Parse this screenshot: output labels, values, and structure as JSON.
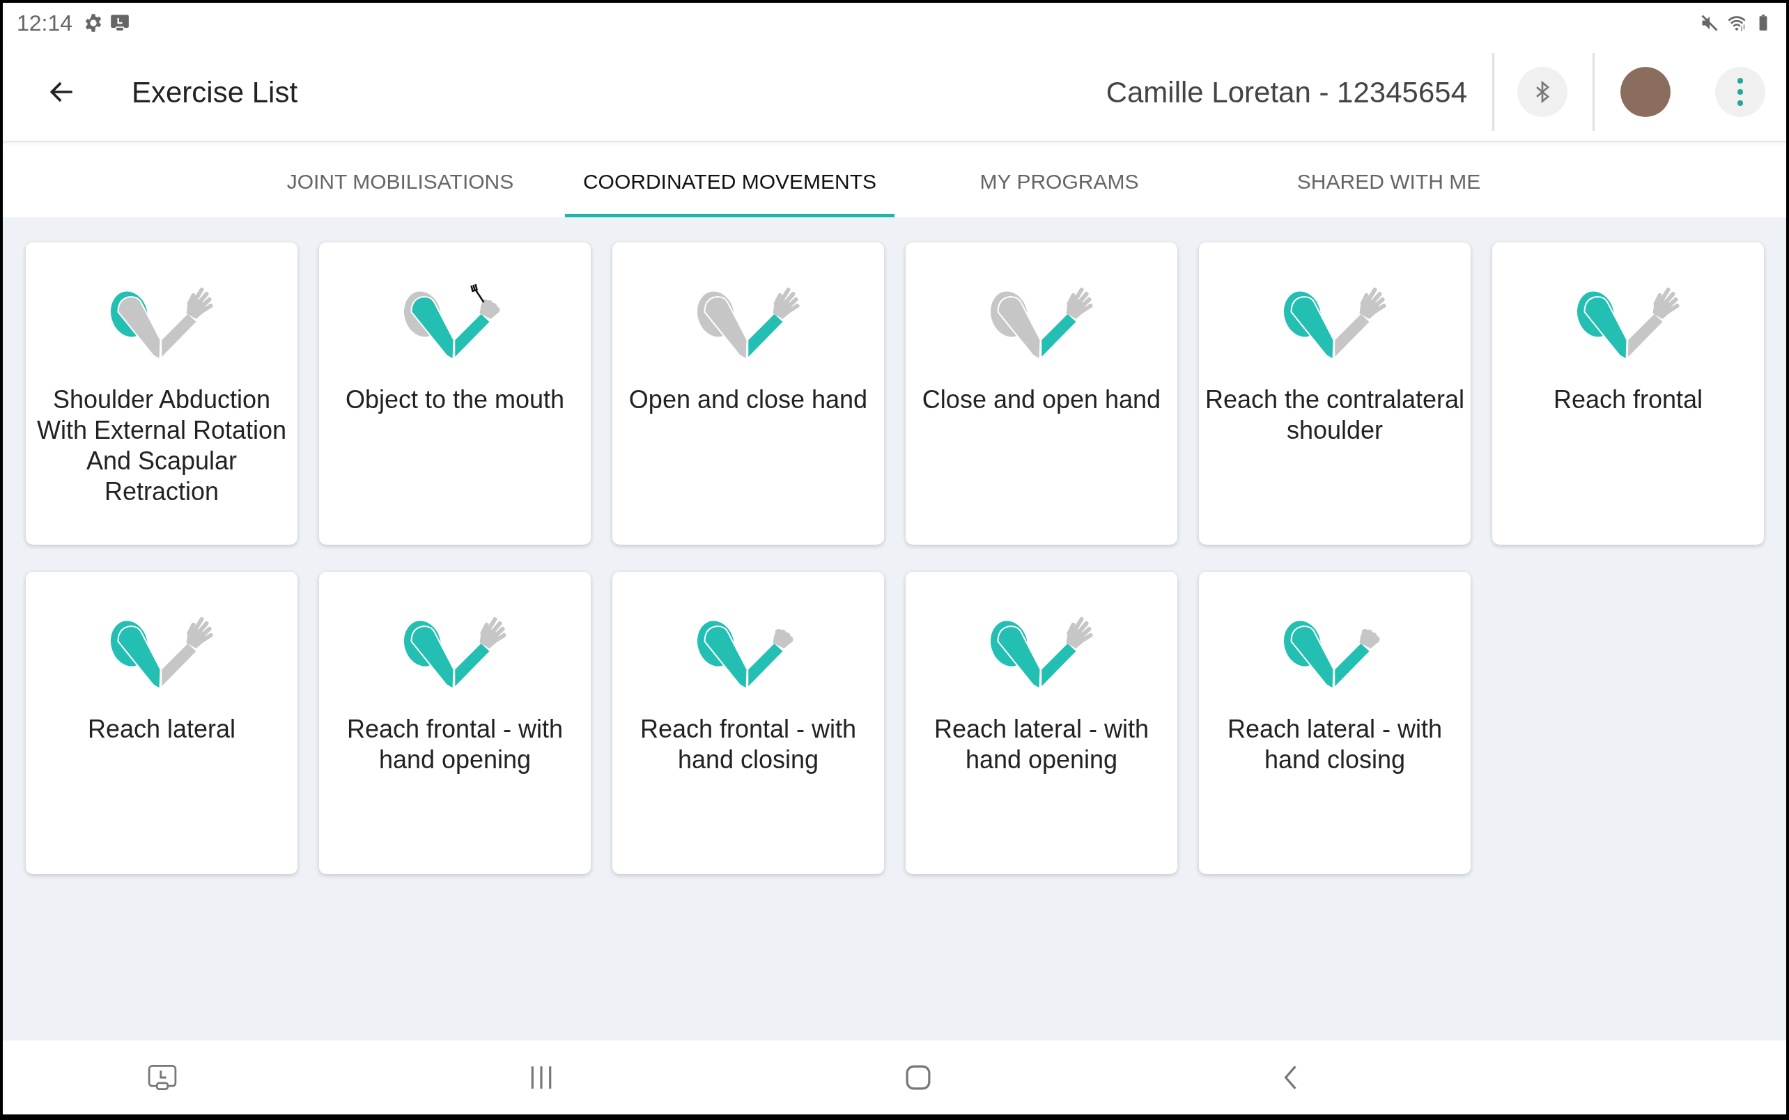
{
  "status_bar": {
    "time": "12:14"
  },
  "header": {
    "title": "Exercise List",
    "patient": "Camille Loretan - 12345654"
  },
  "tabs": [
    {
      "label": "JOINT MOBILISATIONS",
      "selected": false
    },
    {
      "label": "COORDINATED MOVEMENTS",
      "selected": true
    },
    {
      "label": "MY PROGRAMS",
      "selected": false
    },
    {
      "label": "SHARED WITH ME",
      "selected": false
    }
  ],
  "exercises": [
    {
      "title": "Shoulder Abduction With External Rotation And Scapular Retraction",
      "shoulder": true,
      "upper_arm": false,
      "forearm": false,
      "hand_closed": false,
      "utensil": false
    },
    {
      "title": "Object to the mouth",
      "shoulder": false,
      "upper_arm": true,
      "forearm": true,
      "hand_closed": true,
      "utensil": true
    },
    {
      "title": "Open and close hand",
      "shoulder": false,
      "upper_arm": false,
      "forearm": true,
      "hand_closed": false,
      "utensil": false
    },
    {
      "title": "Close and open hand",
      "shoulder": false,
      "upper_arm": false,
      "forearm": true,
      "hand_closed": false,
      "utensil": false
    },
    {
      "title": "Reach the contralateral shoulder",
      "shoulder": true,
      "upper_arm": true,
      "forearm": false,
      "hand_closed": false,
      "utensil": false
    },
    {
      "title": "Reach frontal",
      "shoulder": true,
      "upper_arm": true,
      "forearm": false,
      "hand_closed": false,
      "utensil": false
    },
    {
      "title": "Reach lateral",
      "shoulder": true,
      "upper_arm": true,
      "forearm": false,
      "hand_closed": false,
      "utensil": false
    },
    {
      "title": "Reach frontal - with hand opening",
      "shoulder": true,
      "upper_arm": true,
      "forearm": true,
      "hand_closed": false,
      "utensil": false
    },
    {
      "title": "Reach frontal - with hand closing",
      "shoulder": true,
      "upper_arm": true,
      "forearm": true,
      "hand_closed": true,
      "utensil": false
    },
    {
      "title": "Reach lateral - with hand opening",
      "shoulder": true,
      "upper_arm": true,
      "forearm": true,
      "hand_closed": false,
      "utensil": false
    },
    {
      "title": "Reach lateral - with hand closing",
      "shoulder": true,
      "upper_arm": true,
      "forearm": true,
      "hand_closed": true,
      "utensil": false
    }
  ]
}
